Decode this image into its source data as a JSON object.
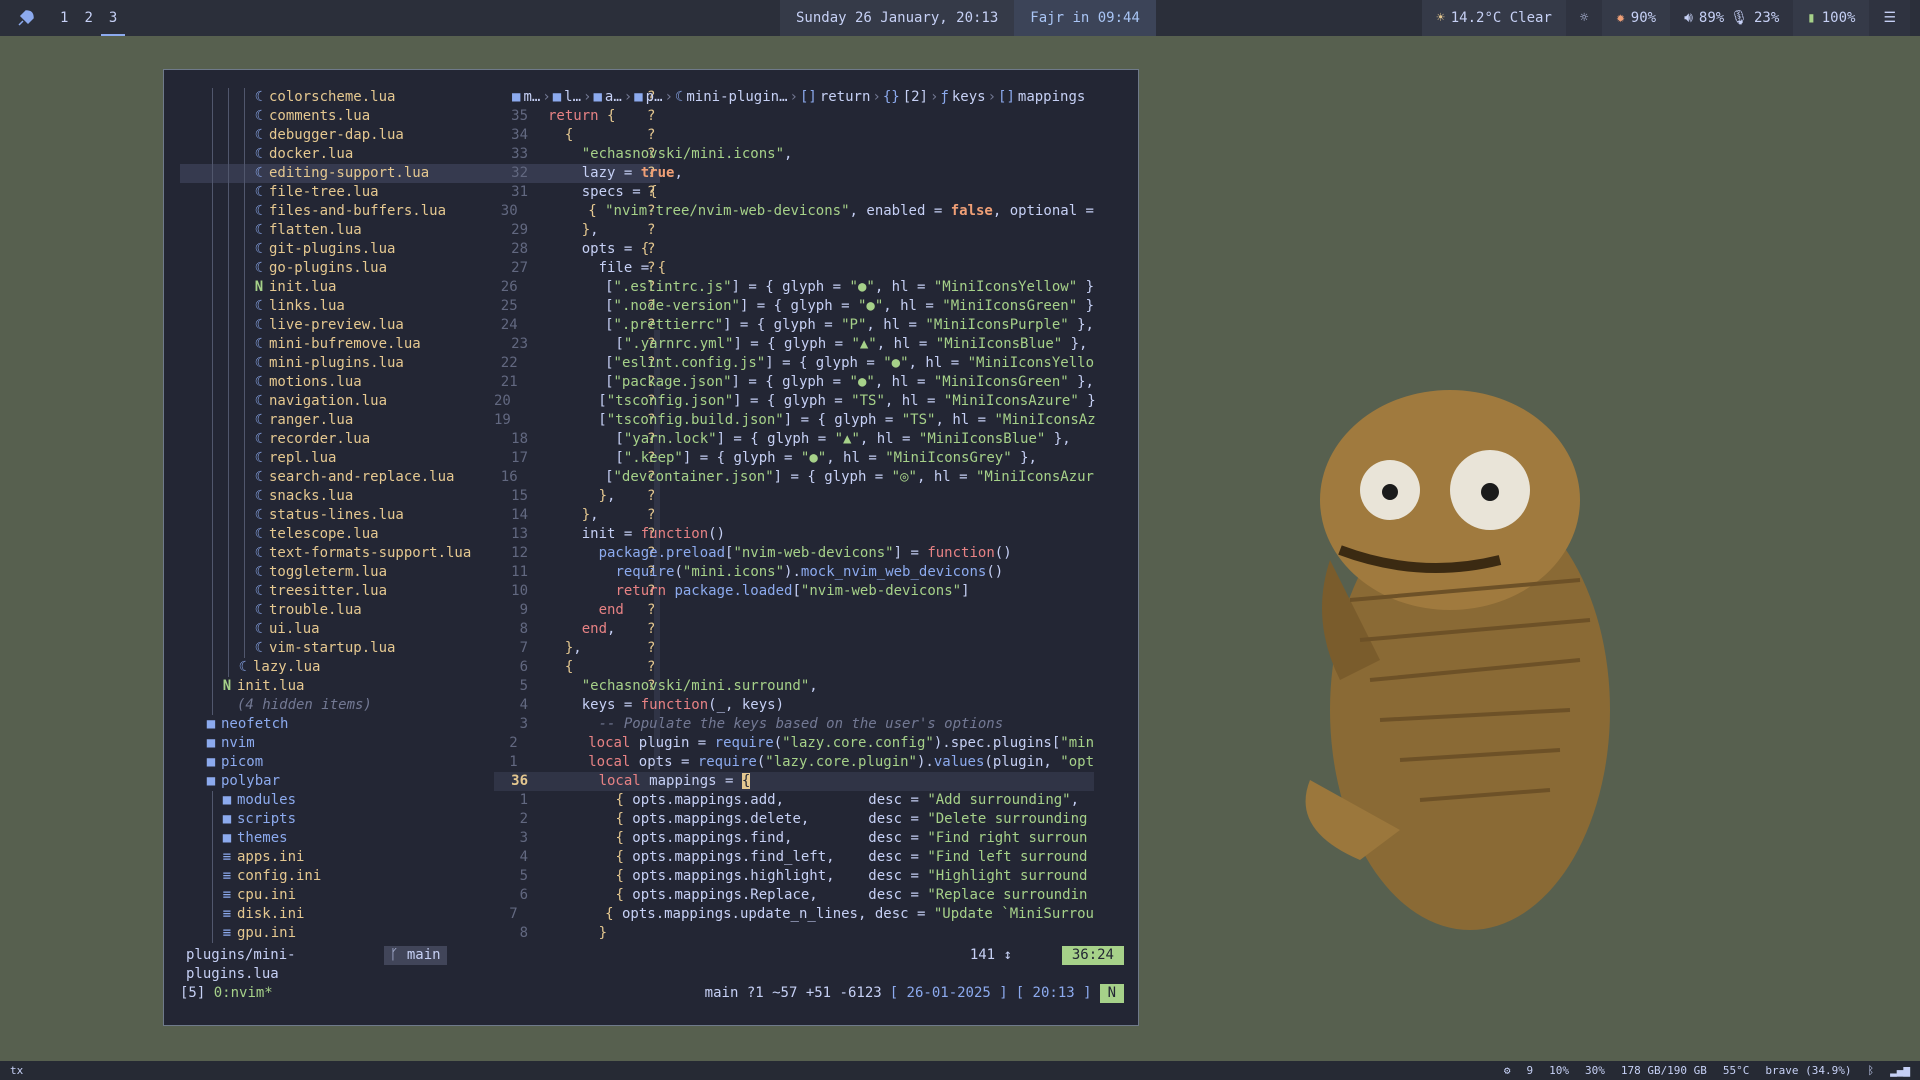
{
  "topbar": {
    "workspaces": [
      "1",
      "2",
      "3"
    ],
    "active_workspace": "3",
    "clock": "Sunday 26 January, 20:13",
    "prayer": "Fajr in 09:44",
    "weather": "14.2°C Clear",
    "brightness": "90%",
    "volume": "89%",
    "mic": "23%",
    "battery": "100%"
  },
  "tree": {
    "files": [
      {
        "name": "colorscheme.lua",
        "icon": "lua",
        "depth": 3,
        "git": "?"
      },
      {
        "name": "comments.lua",
        "icon": "lua",
        "depth": 3,
        "git": "?"
      },
      {
        "name": "debugger-dap.lua",
        "icon": "lua",
        "depth": 3,
        "git": "?"
      },
      {
        "name": "docker.lua",
        "icon": "lua",
        "depth": 3,
        "git": "?"
      },
      {
        "name": "editing-support.lua",
        "icon": "lua",
        "depth": 3,
        "git": "?",
        "selected": true
      },
      {
        "name": "file-tree.lua",
        "icon": "lua",
        "depth": 3,
        "git": "?"
      },
      {
        "name": "files-and-buffers.lua",
        "icon": "lua",
        "depth": 3,
        "git": "?"
      },
      {
        "name": "flatten.lua",
        "icon": "lua",
        "depth": 3,
        "git": "?"
      },
      {
        "name": "git-plugins.lua",
        "icon": "lua",
        "depth": 3,
        "git": "?"
      },
      {
        "name": "go-plugins.lua",
        "icon": "lua",
        "depth": 3,
        "git": "?"
      },
      {
        "name": "init.lua",
        "icon": "nv",
        "depth": 3,
        "git": "?"
      },
      {
        "name": "links.lua",
        "icon": "lua",
        "depth": 3,
        "git": "?"
      },
      {
        "name": "live-preview.lua",
        "icon": "lua",
        "depth": 3,
        "git": "?"
      },
      {
        "name": "mini-bufremove.lua",
        "icon": "lua",
        "depth": 3,
        "git": "?"
      },
      {
        "name": "mini-plugins.lua",
        "icon": "lua",
        "depth": 3,
        "git": "?"
      },
      {
        "name": "motions.lua",
        "icon": "lua",
        "depth": 3,
        "git": "?"
      },
      {
        "name": "navigation.lua",
        "icon": "lua",
        "depth": 3,
        "git": "?"
      },
      {
        "name": "ranger.lua",
        "icon": "lua",
        "depth": 3,
        "git": "?"
      },
      {
        "name": "recorder.lua",
        "icon": "lua",
        "depth": 3,
        "git": "?"
      },
      {
        "name": "repl.lua",
        "icon": "lua",
        "depth": 3,
        "git": "?"
      },
      {
        "name": "search-and-replace.lua",
        "icon": "lua",
        "depth": 3,
        "git": "?"
      },
      {
        "name": "snacks.lua",
        "icon": "lua",
        "depth": 3,
        "git": "?"
      },
      {
        "name": "status-lines.lua",
        "icon": "lua",
        "depth": 3,
        "git": "?"
      },
      {
        "name": "telescope.lua",
        "icon": "lua",
        "depth": 3,
        "git": "?"
      },
      {
        "name": "text-formats-support.lua",
        "icon": "lua",
        "depth": 3,
        "git": "?"
      },
      {
        "name": "toggleterm.lua",
        "icon": "lua",
        "depth": 3,
        "git": "?"
      },
      {
        "name": "treesitter.lua",
        "icon": "lua",
        "depth": 3,
        "git": "?"
      },
      {
        "name": "trouble.lua",
        "icon": "lua",
        "depth": 3,
        "git": "?"
      },
      {
        "name": "ui.lua",
        "icon": "lua",
        "depth": 3,
        "git": "?"
      },
      {
        "name": "vim-startup.lua",
        "icon": "lua",
        "depth": 3,
        "git": "?"
      },
      {
        "name": "lazy.lua",
        "icon": "lua",
        "depth": 2,
        "git": "?"
      },
      {
        "name": "init.lua",
        "icon": "nv",
        "depth": 1,
        "git": "?"
      },
      {
        "name": "(4 hidden items)",
        "icon": "none",
        "depth": 1,
        "hidden": true
      },
      {
        "name": "neofetch",
        "icon": "dir",
        "depth": 0
      },
      {
        "name": "nvim",
        "icon": "dir",
        "depth": 0
      },
      {
        "name": "picom",
        "icon": "dir",
        "depth": 0
      },
      {
        "name": "polybar",
        "icon": "diropen",
        "depth": 0
      },
      {
        "name": "modules",
        "icon": "dir",
        "depth": 1
      },
      {
        "name": "scripts",
        "icon": "dir",
        "depth": 1
      },
      {
        "name": "themes",
        "icon": "dir",
        "depth": 1
      },
      {
        "name": "apps.ini",
        "icon": "ini",
        "depth": 1
      },
      {
        "name": "config.ini",
        "icon": "ini",
        "depth": 1
      },
      {
        "name": "cpu.ini",
        "icon": "ini",
        "depth": 1
      },
      {
        "name": "disk.ini",
        "icon": "ini",
        "depth": 1
      },
      {
        "name": "gpu.ini",
        "icon": "ini",
        "depth": 1
      }
    ]
  },
  "breadcrumb": [
    "m…",
    "l…",
    "a…",
    "p…",
    "mini-plugin…",
    "return",
    "[2]",
    "keys",
    "mappings"
  ],
  "code": [
    {
      "n": "35",
      "h": "<span class=\"kw\">return</span> <span class=\"br\">{</span>"
    },
    {
      "n": "34",
      "h": "  <span class=\"br\">{</span>"
    },
    {
      "n": "33",
      "h": "    <span class=\"str\">\"echasnovski/mini.icons\"</span>,"
    },
    {
      "n": "32",
      "h": "    lazy = <span class=\"kwb\">true</span>,"
    },
    {
      "n": "31",
      "h": "    specs = <span class=\"br\">{</span>"
    },
    {
      "n": "30",
      "h": "      <span class=\"br\">{</span> <span class=\"str\">\"nvim-tree/nvim-web-devicons\"</span>, enabled = <span class=\"kwb\">false</span>, optional ="
    },
    {
      "n": "29",
      "h": "    <span class=\"br\">}</span>,"
    },
    {
      "n": "28",
      "h": "    opts = <span class=\"br\">{</span>"
    },
    {
      "n": "27",
      "h": "      file = <span class=\"br\">{</span>"
    },
    {
      "n": "26",
      "h": "        [<span class=\"str\">\".eslintrc.js\"</span>] = { glyph = <span class=\"str\">\"●\"</span>, hl = <span class=\"str\">\"MiniIconsYellow\"</span> }"
    },
    {
      "n": "25",
      "h": "        [<span class=\"str\">\".node-version\"</span>] = { glyph = <span class=\"str\">\"●\"</span>, hl = <span class=\"str\">\"MiniIconsGreen\"</span> }"
    },
    {
      "n": "24",
      "h": "        [<span class=\"str\">\".prettierrc\"</span>] = { glyph = <span class=\"str\">\"P\"</span>, hl = <span class=\"str\">\"MiniIconsPurple\"</span> },"
    },
    {
      "n": "23",
      "h": "        [<span class=\"str\">\".yarnrc.yml\"</span>] = { glyph = <span class=\"str\">\"▲\"</span>, hl = <span class=\"str\">\"MiniIconsBlue\"</span> },"
    },
    {
      "n": "22",
      "h": "        [<span class=\"str\">\"eslint.config.js\"</span>] = { glyph = <span class=\"str\">\"●\"</span>, hl = <span class=\"str\">\"MiniIconsYello</span>"
    },
    {
      "n": "21",
      "h": "        [<span class=\"str\">\"package.json\"</span>] = { glyph = <span class=\"str\">\"●\"</span>, hl = <span class=\"str\">\"MiniIconsGreen\"</span> },"
    },
    {
      "n": "20",
      "h": "        [<span class=\"str\">\"tsconfig.json\"</span>] = { glyph = <span class=\"str\">\"TS\"</span>, hl = <span class=\"str\">\"MiniIconsAzure\"</span> }"
    },
    {
      "n": "19",
      "h": "        [<span class=\"str\">\"tsconfig.build.json\"</span>] = { glyph = <span class=\"str\">\"TS\"</span>, hl = <span class=\"str\">\"MiniIconsAz</span>"
    },
    {
      "n": "18",
      "h": "        [<span class=\"str\">\"yarn.lock\"</span>] = { glyph = <span class=\"str\">\"▲\"</span>, hl = <span class=\"str\">\"MiniIconsBlue\"</span> },"
    },
    {
      "n": "17",
      "h": "        [<span class=\"str\">\".keep\"</span>] = { glyph = <span class=\"str\">\"●\"</span>, hl = <span class=\"str\">\"MiniIconsGrey\"</span> },"
    },
    {
      "n": "16",
      "h": "        [<span class=\"str\">\"devcontainer.json\"</span>] = { glyph = <span class=\"str\">\"◎\"</span>, hl = <span class=\"str\">\"MiniIconsAzur</span>"
    },
    {
      "n": "15",
      "h": "      <span class=\"br\">}</span>,"
    },
    {
      "n": "14",
      "h": "    <span class=\"br\">}</span>,"
    },
    {
      "n": "13",
      "h": "    init = <span class=\"kw\">function</span>()"
    },
    {
      "n": "12",
      "h": "      <span class=\"fn\">package.preload</span>[<span class=\"str\">\"nvim-web-devicons\"</span>] = <span class=\"kw\">function</span>()"
    },
    {
      "n": "11",
      "h": "        <span class=\"fn\">require</span>(<span class=\"str\">\"mini.icons\"</span>).<span class=\"fn\">mock_nvim_web_devicons</span>()"
    },
    {
      "n": "10",
      "h": "        <span class=\"kw\">return</span> <span class=\"fn\">package.loaded</span>[<span class=\"str\">\"nvim-web-devicons\"</span>]"
    },
    {
      "n": "9",
      "h": "      <span class=\"kw\">end</span>"
    },
    {
      "n": "8",
      "h": "    <span class=\"kw\">end</span>,"
    },
    {
      "n": "7",
      "h": "  <span class=\"br\">}</span>,"
    },
    {
      "n": "6",
      "h": "  <span class=\"br\">{</span>"
    },
    {
      "n": "5",
      "h": "    <span class=\"str\">\"echasnovski/mini.surround\"</span>,"
    },
    {
      "n": "4",
      "h": "    keys = <span class=\"kw\">function</span>(_, keys)"
    },
    {
      "n": "3",
      "h": "      <span class=\"cm\">-- Populate the keys based on the user's options</span>"
    },
    {
      "n": "2",
      "h": "      <span class=\"kw\">local</span> plugin = <span class=\"fn\">require</span>(<span class=\"str\">\"lazy.core.config\"</span>).spec.plugins[<span class=\"str\">\"min</span>"
    },
    {
      "n": "1",
      "h": "      <span class=\"kw\">local</span> opts = <span class=\"fn\">require</span>(<span class=\"str\">\"lazy.core.plugin\"</span>).<span class=\"fn\">values</span>(plugin, <span class=\"str\">\"opt</span>"
    },
    {
      "n": "36",
      "h": "      <span class=\"kw\">local</span> mappings = <span class=\"cursor\">{</span>",
      "cur": true
    },
    {
      "n": "1",
      "h": "        <span class=\"br\">{</span> opts.mappings.add,          desc = <span class=\"str\">\"Add surrounding\"</span>,"
    },
    {
      "n": "2",
      "h": "        <span class=\"br\">{</span> opts.mappings.delete,       desc = <span class=\"str\">\"Delete surrounding</span>"
    },
    {
      "n": "3",
      "h": "        <span class=\"br\">{</span> opts.mappings.find,         desc = <span class=\"str\">\"Find right surroun</span>"
    },
    {
      "n": "4",
      "h": "        <span class=\"br\">{</span> opts.mappings.find_left,    desc = <span class=\"str\">\"Find left surround</span>"
    },
    {
      "n": "5",
      "h": "        <span class=\"br\">{</span> opts.mappings.highlight,    desc = <span class=\"str\">\"Highlight surround</span>"
    },
    {
      "n": "6",
      "h": "        <span class=\"br\">{</span> opts.mappings.Replace,      desc = <span class=\"str\">\"Replace surroundin</span>"
    },
    {
      "n": "7",
      "h": "        <span class=\"br\">{</span> opts.mappings.update_n_lines, desc = <span class=\"str\">\"Update `MiniSurrou</span>"
    },
    {
      "n": "8",
      "h": "      <span class=\"br\">}</span>"
    }
  ],
  "statusline": {
    "path": "plugins/mini-plugins.lua",
    "branch": "main",
    "lines": "141",
    "position": "36:24"
  },
  "tmux": {
    "window_index": "[5]",
    "window_name": "0:nvim*",
    "git": "main ?1 ~57 +51 -6123",
    "date": "[ 26-01-2025 ]",
    "time": "[ 20:13 ]",
    "mode": "N"
  },
  "bottombar": {
    "left": "tx",
    "items": [
      "9",
      "10%",
      "30%",
      "178 GB/190 GB",
      "55°C",
      "brave (34.9%)"
    ]
  }
}
